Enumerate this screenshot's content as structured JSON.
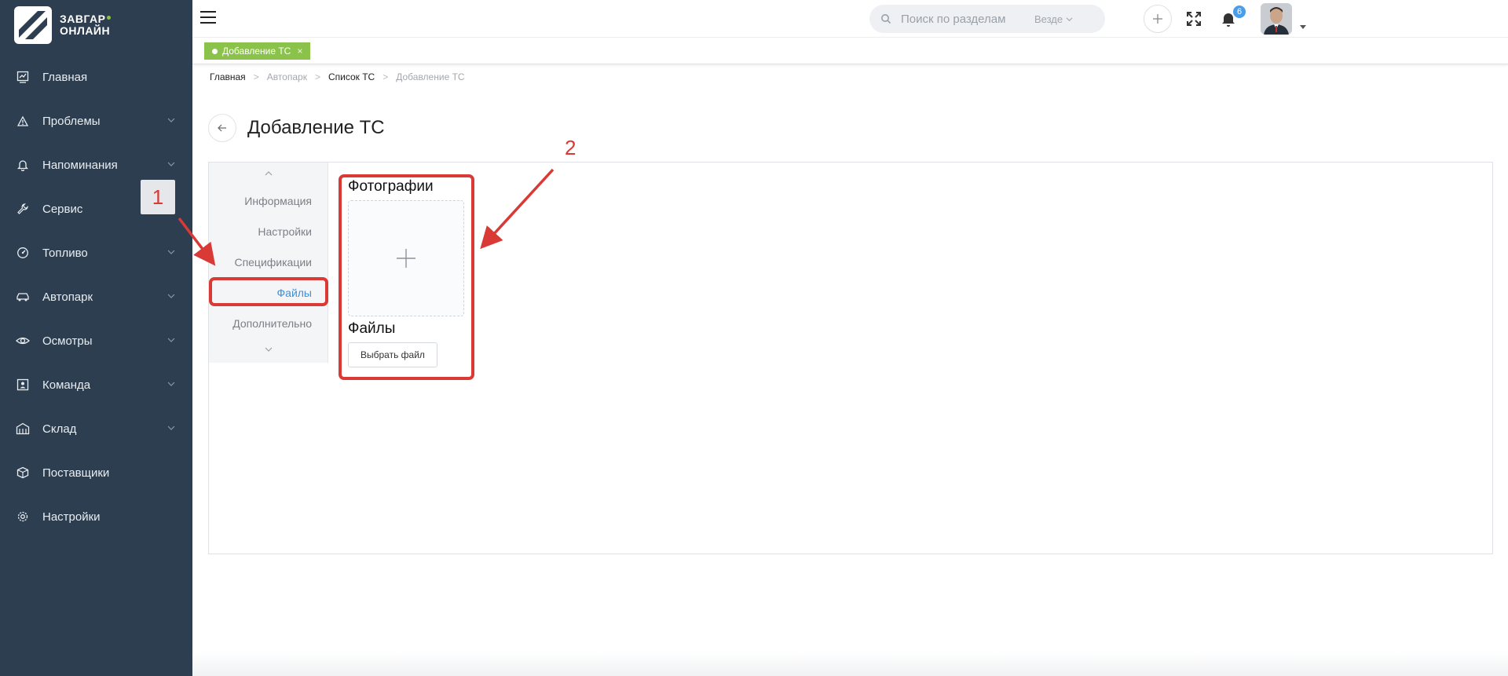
{
  "brand": {
    "line1": "ЗАВГАР",
    "line2": "ОНЛАЙН",
    "accent": "#8bc34a"
  },
  "sidebar": {
    "bg": "#2d3e50",
    "items": [
      {
        "label": "Главная",
        "icon": "dashboard-icon",
        "has_submenu": false
      },
      {
        "label": "Проблемы",
        "icon": "alert-icon",
        "has_submenu": true
      },
      {
        "label": "Напоминания",
        "icon": "bell-icon",
        "has_submenu": true
      },
      {
        "label": "Сервис",
        "icon": "wrench-icon",
        "has_submenu": false
      },
      {
        "label": "Топливо",
        "icon": "fuel-icon",
        "has_submenu": true
      },
      {
        "label": "Автопарк",
        "icon": "car-icon",
        "has_submenu": true
      },
      {
        "label": "Осмотры",
        "icon": "eye-icon",
        "has_submenu": true
      },
      {
        "label": "Команда",
        "icon": "team-icon",
        "has_submenu": true
      },
      {
        "label": "Склад",
        "icon": "warehouse-icon",
        "has_submenu": true
      },
      {
        "label": "Поставщики",
        "icon": "box-icon",
        "has_submenu": false
      },
      {
        "label": "Настройки",
        "icon": "gear-icon",
        "has_submenu": false
      }
    ]
  },
  "topbar": {
    "search_placeholder": "Поиск по разделам",
    "search_scope": "Везде",
    "notifications_count": "6"
  },
  "tabs": [
    {
      "label": "Добавление ТС",
      "close": "×"
    }
  ],
  "breadcrumb": {
    "items": [
      {
        "label": "Главная",
        "muted": false
      },
      {
        "label": "Автопарк",
        "muted": true
      },
      {
        "label": "Список ТС",
        "muted": false
      },
      {
        "label": "Добавление ТС",
        "muted": true
      }
    ],
    "separator": ">"
  },
  "page": {
    "title": "Добавление ТС",
    "side_nav": [
      {
        "label": "Информация",
        "active": false
      },
      {
        "label": "Настройки",
        "active": false
      },
      {
        "label": "Спецификации",
        "active": false
      },
      {
        "label": "Файлы",
        "active": true
      },
      {
        "label": "Дополнительно",
        "active": false
      }
    ],
    "photos_title": "Фотографии",
    "files_title": "Файлы",
    "choose_file_label": "Выбрать файл"
  },
  "annotations": {
    "marker1": "1",
    "marker2": "2",
    "color": "#d93a36"
  }
}
